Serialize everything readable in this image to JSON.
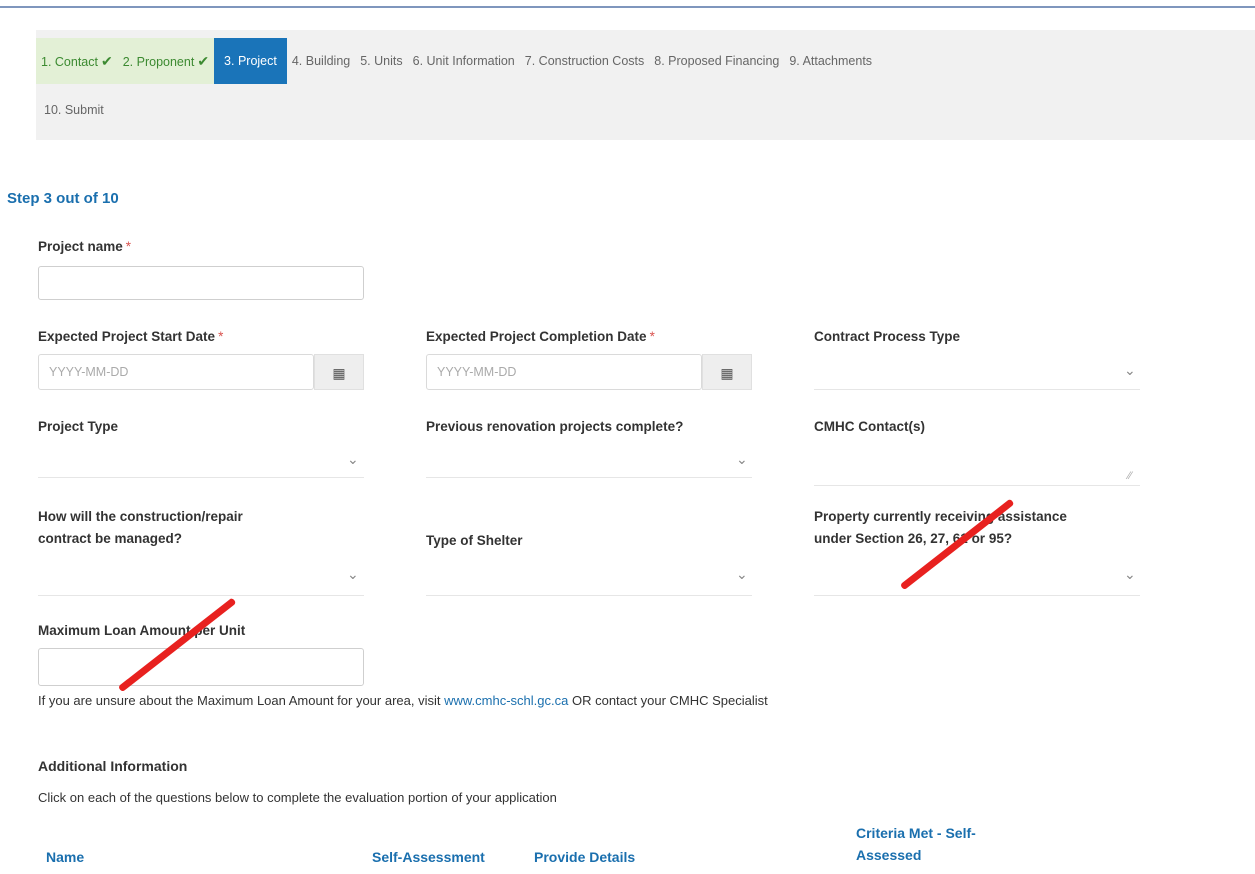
{
  "stepper": {
    "steps": [
      {
        "label": "1. Contact",
        "state": "done"
      },
      {
        "label": "2. Proponent",
        "state": "done"
      },
      {
        "label": "3. Project",
        "state": "active"
      },
      {
        "label": "4. Building",
        "state": "pending"
      },
      {
        "label": "5. Units",
        "state": "pending"
      },
      {
        "label": "6. Unit Information",
        "state": "pending"
      },
      {
        "label": "7. Construction Costs",
        "state": "pending"
      },
      {
        "label": "8. Proposed Financing",
        "state": "pending"
      },
      {
        "label": "9. Attachments",
        "state": "pending"
      },
      {
        "label": "10. Submit",
        "state": "pending"
      }
    ],
    "check_glyph": "✔",
    "progress": {
      "current": 3,
      "total": 10
    }
  },
  "step_count_text": "Step 3 out of 10",
  "form": {
    "project_name": {
      "label": "Project name",
      "value": ""
    },
    "start_date": {
      "label": "Expected Project Start Date",
      "placeholder": "YYYY-MM-DD"
    },
    "completion_date": {
      "label": "Expected Project Completion Date",
      "placeholder": "YYYY-MM-DD"
    },
    "contract_process_type": {
      "label": "Contract Process Type",
      "value": ""
    },
    "project_type": {
      "label": "Project Type",
      "value": ""
    },
    "previous_renovation": {
      "label": "Previous renovation projects complete?",
      "value": ""
    },
    "cmhc_contacts": {
      "label": "CMHC Contact(s)",
      "value": ""
    },
    "contract_managed": {
      "label_line1": "How will the construction/repair",
      "label_line2": "contract be managed?",
      "value": ""
    },
    "shelter_type": {
      "label": "Type of Shelter",
      "value": ""
    },
    "property_assistance": {
      "label_line1": "Property currently receiving assistance",
      "label_line2": "under Section 26, 27, 61 or 95?",
      "value": ""
    },
    "max_loan": {
      "label": "Maximum Loan Amount per Unit",
      "value": ""
    },
    "required_marker": "*"
  },
  "help": {
    "before": "If you are unsure about the Maximum Loan Amount for your area, visit ",
    "link": "www.cmhc-schl.gc.ca",
    "after": " OR contact your CMHC Specialist"
  },
  "additional": {
    "title": "Additional Information",
    "subtitle": "Click on each of the questions below to complete the evaluation portion of your application",
    "columns": {
      "name": "Name",
      "self_assessment": "Self-Assessment",
      "provide_details": "Provide Details",
      "criteria_line1": "Criteria Met - Self-",
      "criteria_line2": "Assessed"
    }
  },
  "icons": {
    "calendar": "calendar-icon",
    "chevron": "chevron-down-icon",
    "checkmark": "checkmark-icon"
  },
  "colors": {
    "active_step": "#1a74b9",
    "done_step_bg": "#e3f0d6",
    "done_step_text": "#3c8a31",
    "link": "#1a6fae",
    "required": "#d9534f",
    "annotation": "#e8211f"
  }
}
